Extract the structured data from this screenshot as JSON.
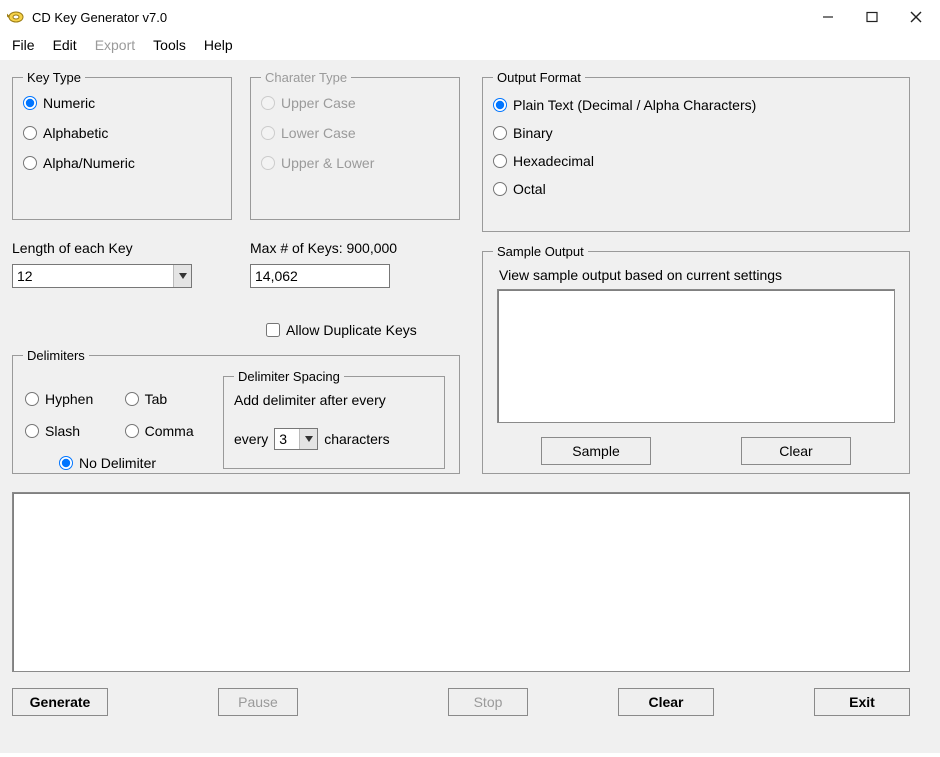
{
  "window": {
    "title": "CD Key Generator v7.0"
  },
  "menu": {
    "file": "File",
    "edit": "Edit",
    "export": "Export",
    "tools": "Tools",
    "help": "Help"
  },
  "keyType": {
    "legend": "Key Type",
    "numeric": "Numeric",
    "alphabetic": "Alphabetic",
    "alphaNumeric": "Alpha/Numeric"
  },
  "charType": {
    "legend": "Charater Type",
    "upper": "Upper Case",
    "lower": "Lower Case",
    "both": "Upper & Lower"
  },
  "length": {
    "label": "Length of each Key",
    "value": "12"
  },
  "maxKeys": {
    "label": "Max # of Keys: 900,000",
    "value": "14,062"
  },
  "allowDup": {
    "label": "Allow Duplicate Keys"
  },
  "delimiters": {
    "legend": "Delimiters",
    "hyphen": "Hyphen",
    "tab": "Tab",
    "slash": "Slash",
    "comma": "Comma",
    "none": "No Delimiter"
  },
  "delimSpacing": {
    "legend": "Delimiter Spacing",
    "prefix": "Add delimiter after every",
    "value": "3",
    "suffix": "characters"
  },
  "outputFormat": {
    "legend": "Output Format",
    "plain": "Plain Text (Decimal / Alpha Characters)",
    "binary": "Binary",
    "hex": "Hexadecimal",
    "octal": "Octal"
  },
  "sampleOutput": {
    "legend": "Sample Output",
    "hint": "View sample output based on current settings",
    "sampleBtn": "Sample",
    "clearBtn": "Clear"
  },
  "footer": {
    "generate": "Generate",
    "pause": "Pause",
    "stop": "Stop",
    "clear": "Clear",
    "exit": "Exit"
  }
}
